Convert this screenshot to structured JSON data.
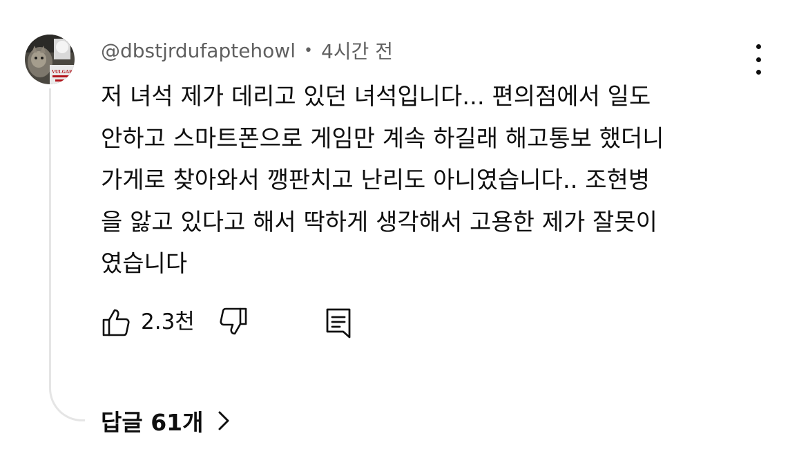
{
  "comment": {
    "author": "@dbstjrdufaptehowl",
    "separator": "•",
    "time": "4시간 전",
    "text": "저 녀석 제가 데리고 있던 녀석입니다... 편의점에서 일도\n안하고 스마트폰으로 게임만 계속 하길래 해고통보 했더니\n가게로 찾아와서 깽판치고 난리도 아니였습니다.. 조현병\n을 앓고 있다고 해서 딱하게 생각해서 고용한 제가 잘못이\n였습니다",
    "avatar_text": "VULGAR",
    "avatar_icon": "cat-avatar",
    "more_icon": "more-vertical-icon"
  },
  "actions": {
    "like_icon": "thumbs-up-icon",
    "like_count": "2.3천",
    "dislike_icon": "thumbs-down-icon",
    "reply_icon": "comment-reply-icon"
  },
  "replies": {
    "label": "답글 61개",
    "chevron_icon": "chevron-right-icon"
  },
  "colors": {
    "text_primary": "#0f0f0f",
    "text_secondary": "#606060",
    "thread_line": "#e5e5e5"
  }
}
